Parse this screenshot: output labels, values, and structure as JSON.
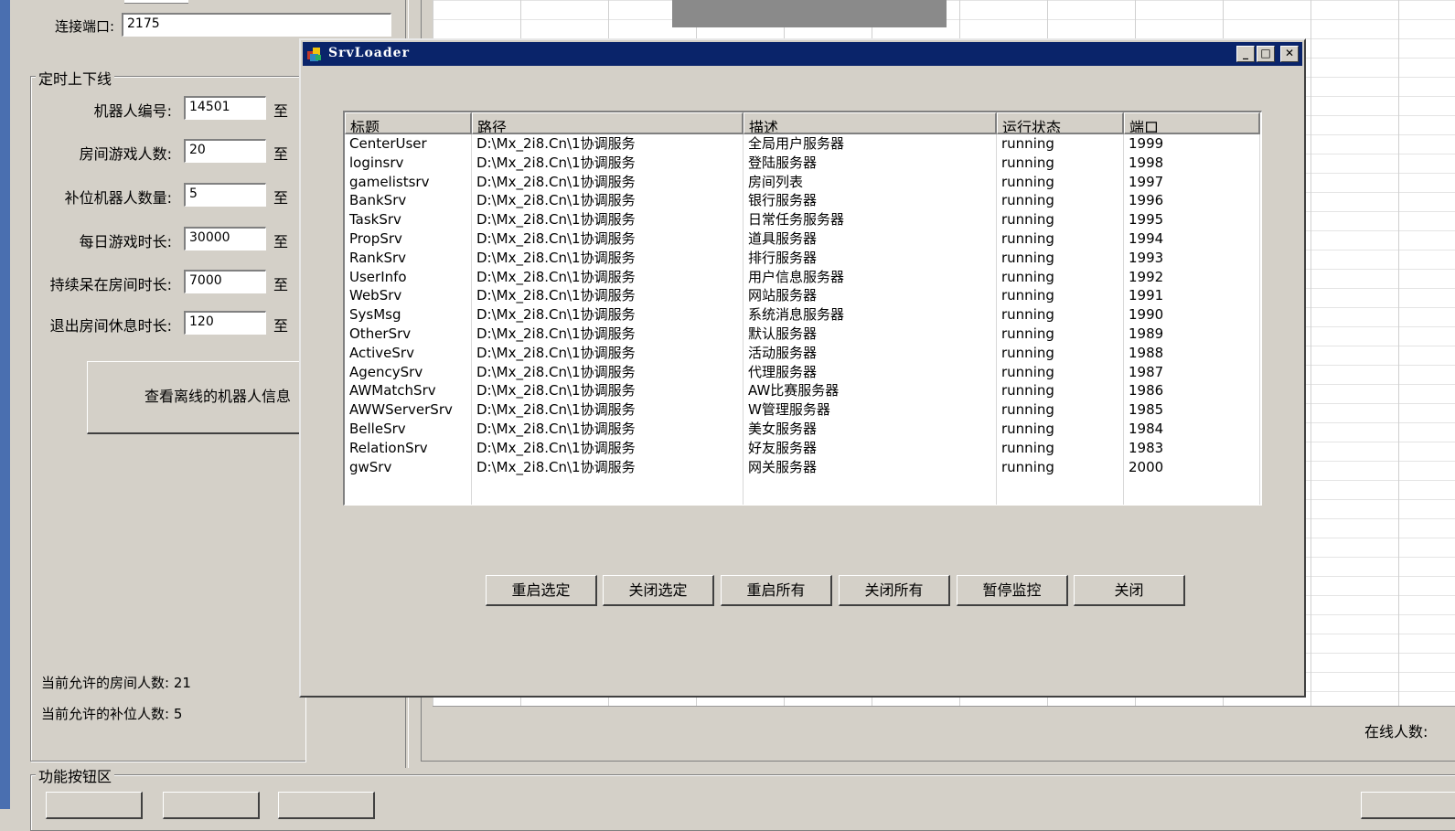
{
  "background_app": {
    "port_label": "连接端口:",
    "port_value": "2175",
    "schedule_group_title": "定时上下线",
    "fields": [
      {
        "label": "机器人编号:",
        "value": "14501",
        "to": "至"
      },
      {
        "label": "房间游戏人数:",
        "value": "20",
        "to": "至"
      },
      {
        "label": "补位机器人数量:",
        "value": "5",
        "to": "至"
      },
      {
        "label": "每日游戏时长:",
        "value": "30000",
        "to": "至"
      },
      {
        "label": "持续呆在房间时长:",
        "value": "7000",
        "to": "至"
      },
      {
        "label": "退出房间休息时长:",
        "value": "120",
        "to": "至"
      }
    ],
    "offline_button": "查看离线的机器人信息",
    "room_allowed": "当前允许的房间人数: 21",
    "fill_allowed": "当前允许的补位人数: 5",
    "function_group_title": "功能按钮区",
    "online_label": "在线人数:"
  },
  "dialog": {
    "title": "SrvLoader",
    "caption_buttons": {
      "minimize": "_",
      "maximize": "□",
      "close": "✕"
    },
    "columns": [
      "标题",
      "路径",
      "描述",
      "运行状态",
      "端口"
    ],
    "rows": [
      [
        "CenterUser",
        "D:\\Mx_2i8.Cn\\1协调服务",
        "全局用户服务器",
        "running",
        "1999"
      ],
      [
        "loginsrv",
        "D:\\Mx_2i8.Cn\\1协调服务",
        "登陆服务器",
        "running",
        "1998"
      ],
      [
        "gamelistsrv",
        "D:\\Mx_2i8.Cn\\1协调服务",
        "房间列表",
        "running",
        "1997"
      ],
      [
        "BankSrv",
        "D:\\Mx_2i8.Cn\\1协调服务",
        "银行服务器",
        "running",
        "1996"
      ],
      [
        "TaskSrv",
        "D:\\Mx_2i8.Cn\\1协调服务",
        "日常任务服务器",
        "running",
        "1995"
      ],
      [
        "PropSrv",
        "D:\\Mx_2i8.Cn\\1协调服务",
        "道具服务器",
        "running",
        "1994"
      ],
      [
        "RankSrv",
        "D:\\Mx_2i8.Cn\\1协调服务",
        "排行服务器",
        "running",
        "1993"
      ],
      [
        "UserInfo",
        "D:\\Mx_2i8.Cn\\1协调服务",
        "用户信息服务器",
        "running",
        "1992"
      ],
      [
        "WebSrv",
        "D:\\Mx_2i8.Cn\\1协调服务",
        "网站服务器",
        "running",
        "1991"
      ],
      [
        "SysMsg",
        "D:\\Mx_2i8.Cn\\1协调服务",
        "系统消息服务器",
        "running",
        "1990"
      ],
      [
        "OtherSrv",
        "D:\\Mx_2i8.Cn\\1协调服务",
        "默认服务器",
        "running",
        "1989"
      ],
      [
        "ActiveSrv",
        "D:\\Mx_2i8.Cn\\1协调服务",
        "活动服务器",
        "running",
        "1988"
      ],
      [
        "AgencySrv",
        "D:\\Mx_2i8.Cn\\1协调服务",
        "代理服务器",
        "running",
        "1987"
      ],
      [
        "AWMatchSrv",
        "D:\\Mx_2i8.Cn\\1协调服务",
        "AW比赛服务器",
        "running",
        "1986"
      ],
      [
        "AWWServerSrv",
        "D:\\Mx_2i8.Cn\\1协调服务",
        "W管理服务器",
        "running",
        "1985"
      ],
      [
        "BelleSrv",
        "D:\\Mx_2i8.Cn\\1协调服务",
        "美女服务器",
        "running",
        "1984"
      ],
      [
        "RelationSrv",
        "D:\\Mx_2i8.Cn\\1协调服务",
        "好友服务器",
        "running",
        "1983"
      ],
      [
        "gwSrv",
        "D:\\Mx_2i8.Cn\\1协调服务",
        "网关服务器",
        "running",
        "2000"
      ]
    ],
    "buttons": [
      "重启选定",
      "关闭选定",
      "重启所有",
      "关闭所有",
      "暂停监控",
      "关闭"
    ]
  },
  "colors": {
    "face": "#d4d0c8",
    "titlebar": "#0a246a",
    "desktop_strip": "#4a6fb0"
  }
}
